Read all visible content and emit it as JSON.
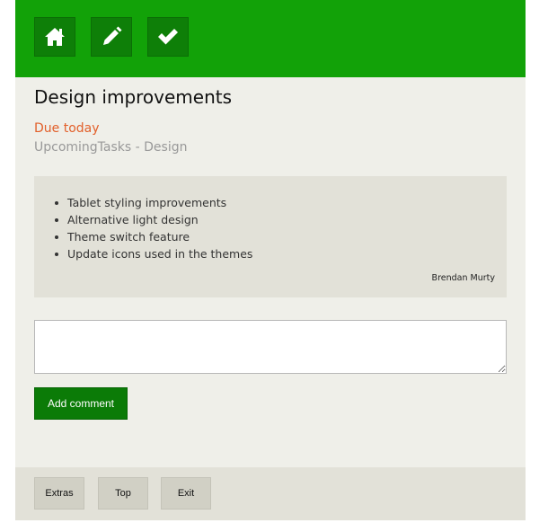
{
  "toolbar": {
    "home_icon": "home-icon",
    "edit_icon": "pencil-icon",
    "done_icon": "check-icon",
    "color": "#12a208"
  },
  "task": {
    "title": "Design improvements",
    "due": "Due today",
    "project": "UpcomingTasks - Design",
    "description_items": [
      "Tablet styling improvements",
      "Alternative light design",
      "Theme switch feature",
      "Update icons used in the themes"
    ],
    "author": "Brendan Murty"
  },
  "comment": {
    "value": "",
    "button_label": "Add comment"
  },
  "footer": {
    "extras_label": "Extras",
    "top_label": "Top",
    "exit_label": "Exit"
  },
  "colors": {
    "accent": "#12a208",
    "button_dark": "#0b7b07",
    "due": "#e2602b"
  }
}
